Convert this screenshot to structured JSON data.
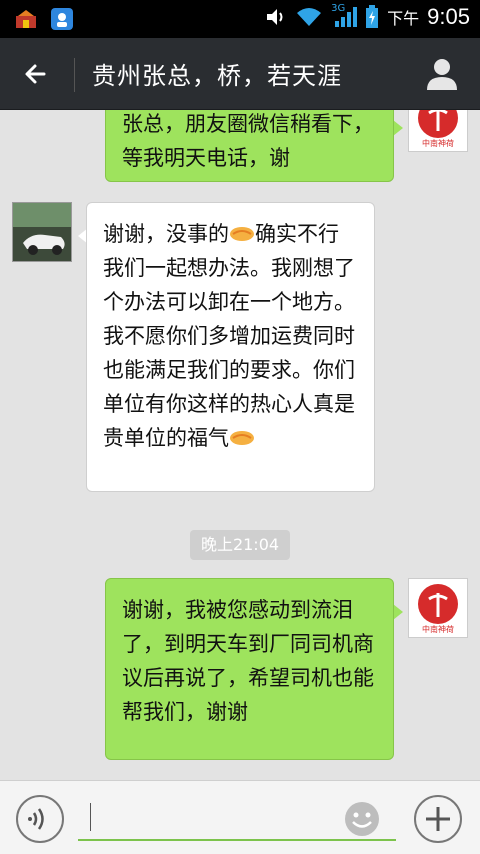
{
  "status_bar": {
    "network_label": "3G",
    "ampm": "下午",
    "time": "9:05"
  },
  "header": {
    "title": "贵州张总，桥，若天涯"
  },
  "messages": [
    {
      "side": "right",
      "text": "张总，朋友圈微信稍看下，等我明天电话，谢"
    },
    {
      "side": "left",
      "text_parts": [
        "谢谢，没事的",
        "确实不行我们一起想办法。我刚想了个办法可以卸在一个地方。我不愿你们多增加运费同时也能满足我们的要求。你们单位有你这样的热心人真是贵单位的福气"
      ]
    },
    {
      "side": "right",
      "text": "谢谢，我被您感动到流泪了，到明天车到厂同司机商议后再说了，希望司机也能帮我们，谢谢"
    }
  ],
  "timestamp": "晚上21:04",
  "right_avatar_logo_text": "中南神荷",
  "input": {
    "value": ""
  },
  "icons": {
    "back": "arrow-left-icon",
    "profile": "person-icon",
    "voice": "voice-icon",
    "emoji": "smiley-icon",
    "plus": "plus-icon",
    "handshake": "handshake-emoji-icon"
  },
  "colors": {
    "header_bg": "#2a2d31",
    "sent_bubble": "#9ee35d",
    "received_bubble": "#ffffff",
    "chat_bg": "#e3e3e3",
    "input_underline": "#7cc34c"
  }
}
